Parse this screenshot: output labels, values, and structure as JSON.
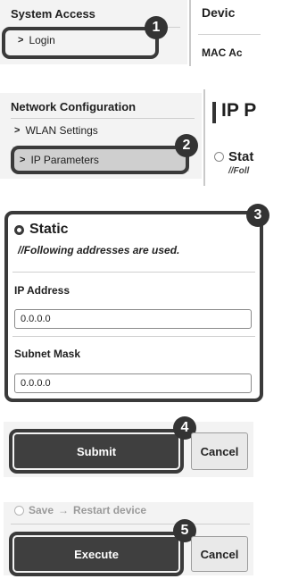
{
  "section1": {
    "title": "System Access",
    "login_label": "Login",
    "right_title": "Devic",
    "right_item": "MAC Ac",
    "badge": "1"
  },
  "section2": {
    "title": "Network Configuration",
    "wlan_label": "WLAN Settings",
    "ip_label": "IP Parameters",
    "right_title": "IP P",
    "right_radio_label": "Stat",
    "right_subtext": "//Foll",
    "badge": "2"
  },
  "section3": {
    "radio_label": "Static",
    "subtext": "//Following addresses are used.",
    "ip_label": "IP Address",
    "ip_value": "0.0.0.0",
    "mask_label": "Subnet Mask",
    "mask_value": "0.0.0.0",
    "badge": "3"
  },
  "section4": {
    "submit_label": "Submit",
    "cancel_label": "Cancel",
    "badge": "4"
  },
  "section5": {
    "save_label": "Save",
    "restart_label": "Restart device",
    "arrow": "→",
    "execute_label": "Execute",
    "cancel_label": "Cancel",
    "badge": "5"
  }
}
